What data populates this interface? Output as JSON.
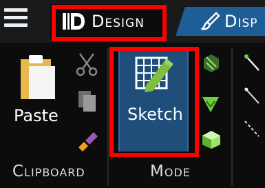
{
  "tabs": {
    "design_label": "Design",
    "display_label": "Disp"
  },
  "clipboard": {
    "paste_label": "Paste",
    "group_label": "Clipboard"
  },
  "mode": {
    "sketch_label": "Sketch",
    "group_label": "Mode"
  },
  "colors": {
    "highlight": "#ff0000",
    "tab_active_blue": "#1f5d97",
    "sketch_bg": "#1f4e7a"
  },
  "icons": [
    "hamburger-menu-icon",
    "design-logo-icon",
    "paintbrush-icon",
    "paste-icon",
    "scissors-icon",
    "copy-icon",
    "format-painter-icon",
    "sketch-grid-pencil-icon",
    "mode-3d-icon",
    "mode-section-icon",
    "mode-solid-icon",
    "line-tool-icon"
  ]
}
